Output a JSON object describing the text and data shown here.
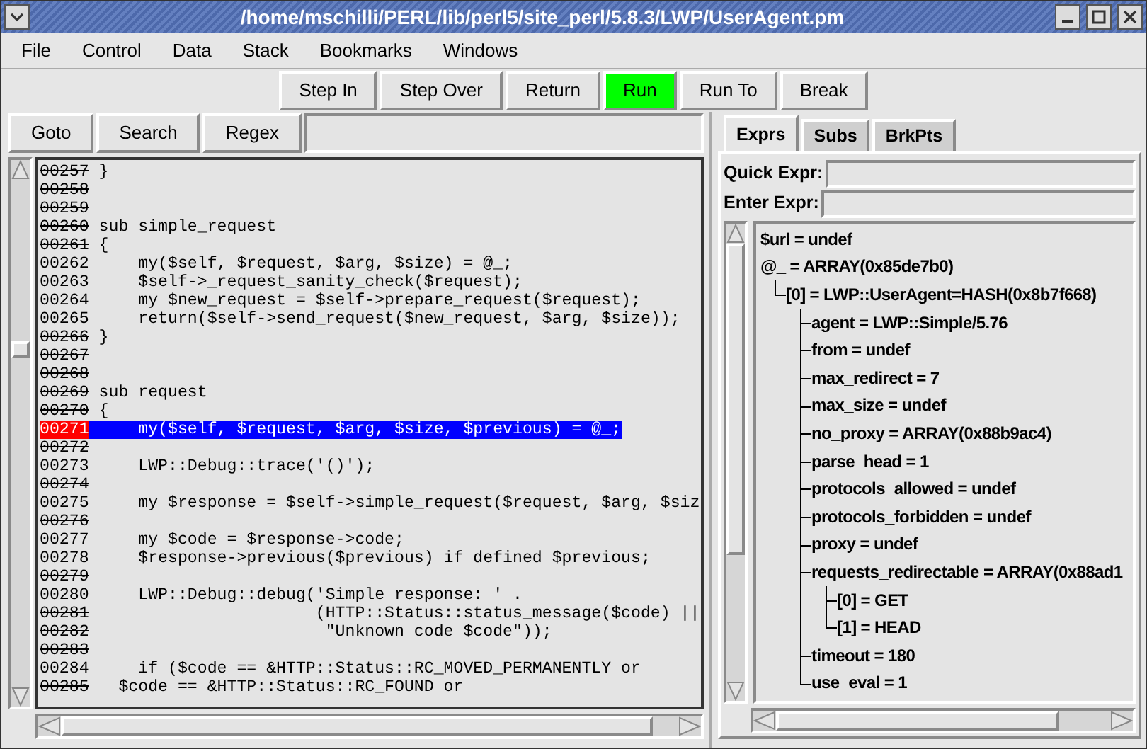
{
  "window": {
    "title": "/home/mschilli/PERL/lib/perl5/site_perl/5.8.3/LWP/UserAgent.pm"
  },
  "menu": [
    "File",
    "Control",
    "Data",
    "Stack",
    "Bookmarks",
    "Windows"
  ],
  "toolbar": [
    {
      "label": "Step In",
      "highlighted": false
    },
    {
      "label": "Step Over",
      "highlighted": false
    },
    {
      "label": "Return",
      "highlighted": false
    },
    {
      "label": "Run",
      "highlighted": true
    },
    {
      "label": "Run To",
      "highlighted": false
    },
    {
      "label": "Break",
      "highlighted": false
    }
  ],
  "search_bar": {
    "buttons": [
      "Goto",
      "Search",
      "Regex"
    ]
  },
  "code": [
    {
      "number": "00257",
      "text": "}",
      "breakable": false,
      "current": false
    },
    {
      "number": "00258",
      "breakable": false,
      "current": false
    },
    {
      "number": "00259",
      "breakable": false,
      "current": false
    },
    {
      "number": "00260",
      "text": "sub simple_request",
      "breakable": false,
      "current": false
    },
    {
      "number": "00261",
      "text": "{",
      "breakable": false,
      "current": false
    },
    {
      "number": "00262",
      "text": "    my($self, $request, $arg, $size) = @_;",
      "breakable": true,
      "current": false
    },
    {
      "number": "00263",
      "text": "    $self->_request_sanity_check($request);",
      "breakable": true,
      "current": false
    },
    {
      "number": "00264",
      "text": "    my $new_request = $self->prepare_request($request);",
      "breakable": true,
      "current": false
    },
    {
      "number": "00265",
      "text": "    return($self->send_request($new_request, $arg, $size));",
      "breakable": true,
      "current": false
    },
    {
      "number": "00266",
      "text": "}",
      "breakable": false,
      "current": false
    },
    {
      "number": "00267",
      "breakable": false,
      "current": false
    },
    {
      "number": "00268",
      "breakable": false,
      "current": false
    },
    {
      "number": "00269",
      "text": "sub request",
      "breakable": false,
      "current": false
    },
    {
      "number": "00270",
      "text": "{",
      "breakable": false,
      "current": false
    },
    {
      "number": "00271",
      "text": "    my($self, $request, $arg, $size, $previous) = @_;",
      "breakable": true,
      "current": true
    },
    {
      "number": "00272",
      "breakable": false,
      "current": false
    },
    {
      "number": "00273",
      "text": "    LWP::Debug::trace('()');",
      "breakable": true,
      "current": false
    },
    {
      "number": "00274",
      "breakable": false,
      "current": false
    },
    {
      "number": "00275",
      "text": "    my $response = $self->simple_request($request, $arg, $siz",
      "breakable": true,
      "current": false
    },
    {
      "number": "00276",
      "breakable": false,
      "current": false
    },
    {
      "number": "00277",
      "text": "    my $code = $response->code;",
      "breakable": true,
      "current": false
    },
    {
      "number": "00278",
      "text": "    $response->previous($previous) if defined $previous;",
      "breakable": true,
      "current": false
    },
    {
      "number": "00279",
      "breakable": false,
      "current": false
    },
    {
      "number": "00280",
      "text": "    LWP::Debug::debug('Simple response: ' .",
      "breakable": true,
      "current": false
    },
    {
      "number": "00281",
      "text": "                      (HTTP::Status::status_message($code) ||",
      "breakable": false,
      "current": false
    },
    {
      "number": "00282",
      "text": "                       \"Unknown code $code\"));",
      "breakable": false,
      "current": false
    },
    {
      "number": "00283",
      "breakable": false,
      "current": false
    },
    {
      "number": "00284",
      "text": "    if ($code == &HTTP::Status::RC_MOVED_PERMANENTLY or",
      "breakable": true,
      "current": false
    },
    {
      "number": "00285",
      "text": "  $code == &HTTP::Status::RC_FOUND or",
      "breakable": false,
      "current": false
    }
  ],
  "tabs": [
    {
      "label": "Exprs",
      "selected": true
    },
    {
      "label": "Subs",
      "selected": false
    },
    {
      "label": "BrkPts",
      "selected": false
    }
  ],
  "expr_fields": [
    {
      "label": "Quick Expr:"
    },
    {
      "label": "Enter Expr:"
    }
  ],
  "tree": [
    {
      "text": "$url = undef"
    },
    {
      "text": "@_ = ARRAY(0x85de7b0)",
      "children": [
        {
          "text": "[0] = LWP::UserAgent=HASH(0x8b7f668)",
          "children": [
            {
              "text": "agent = LWP::Simple/5.76"
            },
            {
              "text": "from = undef"
            },
            {
              "text": "max_redirect = 7"
            },
            {
              "text": "max_size = undef"
            },
            {
              "text": "no_proxy = ARRAY(0x88b9ac4)"
            },
            {
              "text": "parse_head = 1"
            },
            {
              "text": "protocols_allowed = undef"
            },
            {
              "text": "protocols_forbidden = undef"
            },
            {
              "text": "proxy = undef"
            },
            {
              "text": "requests_redirectable = ARRAY(0x88ad1",
              "children": [
                {
                  "text": "[0] = GET"
                },
                {
                  "text": "[1] = HEAD"
                }
              ]
            },
            {
              "text": "timeout = 180"
            },
            {
              "text": "use_eval = 1"
            }
          ]
        }
      ]
    }
  ]
}
